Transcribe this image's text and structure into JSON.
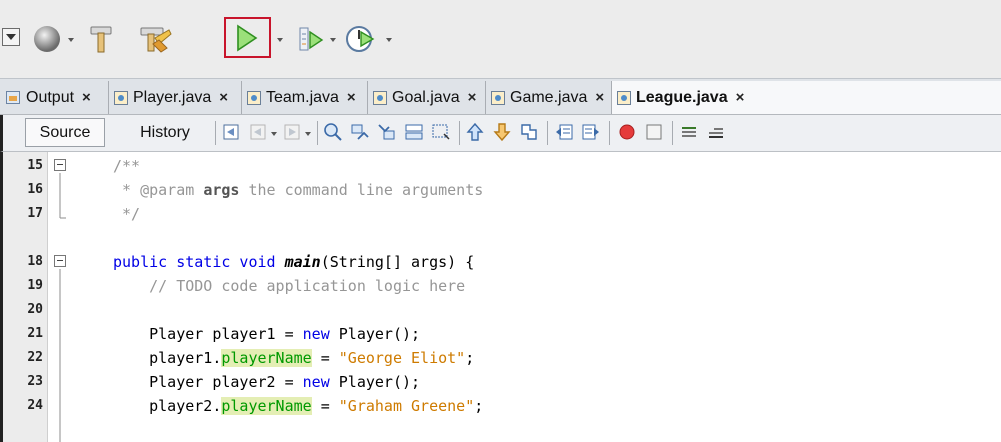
{
  "top_toolbar": {
    "icons": [
      {
        "name": "menu-dropdown-icon"
      },
      {
        "name": "globe-icon"
      },
      {
        "name": "hammer-build-icon"
      },
      {
        "name": "clean-build-icon"
      },
      {
        "name": "run-project-icon"
      },
      {
        "name": "debug-project-icon"
      },
      {
        "name": "profile-project-icon"
      }
    ],
    "highlight_color": "#c8142b"
  },
  "tabs": [
    {
      "label": "Output",
      "icon": "output-icon",
      "active": false
    },
    {
      "label": "Player.java",
      "icon": "java-file-icon",
      "active": false
    },
    {
      "label": "Team.java",
      "icon": "java-file-icon",
      "active": false
    },
    {
      "label": "Goal.java",
      "icon": "java-file-icon",
      "active": false
    },
    {
      "label": "Game.java",
      "icon": "java-file-icon",
      "active": false
    },
    {
      "label": "League.java",
      "icon": "java-file-icon",
      "active": true
    }
  ],
  "tab_close_glyph": "×",
  "editor_toolbar": {
    "source_label": "Source",
    "history_label": "History"
  },
  "code": {
    "line_numbers": [
      "15",
      "16",
      "17",
      "18",
      "19",
      "20",
      "21",
      "22",
      "23",
      "24"
    ],
    "fold_markers_on": [
      "15",
      "18"
    ],
    "lines": {
      "l15": "/**",
      "l16a": " * @param ",
      "l16b": "args",
      "l16c": " the command line arguments",
      "l17": " */",
      "l18a": "public static void ",
      "l18b": "main",
      "l18c": "(String[] args) {",
      "l19": "    // TODO code application logic here",
      "l20": "",
      "l21a": "    Player player1 = ",
      "l21b": "new",
      "l21c": " Player();",
      "l22a": "    player1.",
      "l22b": "playerName",
      "l22c": " = ",
      "l22d": "\"George Eliot\"",
      "l22e": ";",
      "l23a": "    Player player2 = ",
      "l23b": "new",
      "l23c": " Player();",
      "l24a": "    player2.",
      "l24b": "playerName",
      "l24c": " = ",
      "l24d": "\"Graham Greene\"",
      "l24e": ";"
    }
  },
  "colors": {
    "keyword": "#0000e6",
    "string": "#ce7b00",
    "comment": "#969696",
    "field": "#009900",
    "field_highlight": "#e4eeb4"
  }
}
